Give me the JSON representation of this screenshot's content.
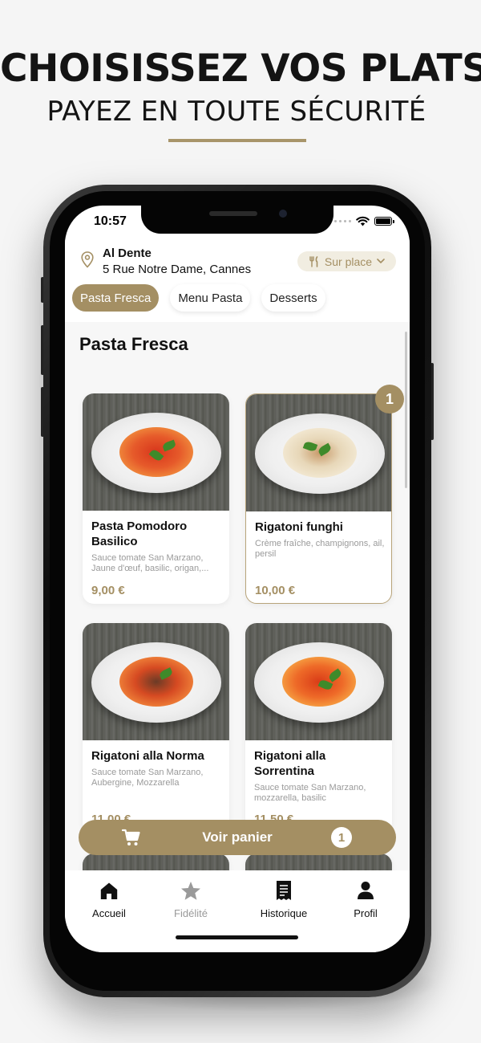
{
  "promo": {
    "headline": "CHOISISSEZ VOS PLATS",
    "subline": "PAYEZ EN TOUTE SÉCURITÉ"
  },
  "status_bar": {
    "time": "10:57"
  },
  "restaurant": {
    "name": "Al Dente",
    "address": "5 Rue Notre Dame, Cannes",
    "service_mode": "Sur place"
  },
  "categories": [
    {
      "label": "Pasta Fresca",
      "active": true
    },
    {
      "label": "Menu Pasta",
      "active": false
    },
    {
      "label": "Desserts",
      "active": false
    }
  ],
  "section_title": "Pasta Fresca",
  "dishes": [
    {
      "name": "Pasta Pomodoro Basilico",
      "description": "Sauce tomate San Marzano, Jaune d'œuf, basilic, origan,...",
      "price": "9,00 €",
      "quantity": ""
    },
    {
      "name": "Rigatoni funghi",
      "description": "Crème fraîche, champignons, ail, persil",
      "price": "10,00 €",
      "quantity": "1"
    },
    {
      "name": "Rigatoni alla Norma",
      "description": "Sauce tomate San Marzano, Aubergine, Mozzarella",
      "price": "11,00 €",
      "quantity": ""
    },
    {
      "name": "Rigatoni alla Sorrentina",
      "description": "Sauce tomate San Marzano, mozzarella, basilic",
      "price": "11,50 €",
      "quantity": ""
    }
  ],
  "cart": {
    "label": "Voir panier",
    "count": "1",
    "icon": "cart-icon"
  },
  "nav": [
    {
      "label": "Accueil",
      "icon": "home-icon",
      "active": true
    },
    {
      "label": "Fidélité",
      "icon": "star-icon",
      "active": false
    },
    {
      "label": "Historique",
      "icon": "receipt-icon",
      "active": false
    },
    {
      "label": "Profil",
      "icon": "person-icon",
      "active": false
    }
  ],
  "colors": {
    "accent": "#a48f63",
    "accent_light": "#f1ede1",
    "rule": "#a8956a"
  }
}
